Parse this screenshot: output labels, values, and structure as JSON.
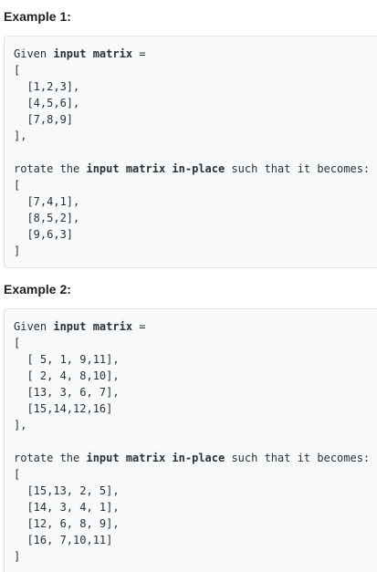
{
  "example1": {
    "heading": "Example 1:",
    "lines": [
      "Given input matrix =",
      "[",
      "  [1,2,3],",
      "  [4,5,6],",
      "  [7,8,9]",
      "],",
      "",
      "rotate the input matrix in-place such that it becomes:",
      "[",
      "  [7,4,1],",
      "  [8,5,2],",
      "  [9,6,3]",
      "]"
    ]
  },
  "example2": {
    "heading": "Example 2:",
    "lines": [
      "Given input matrix =",
      "[",
      "  [ 5, 1, 9,11],",
      "  [ 2, 4, 8,10],",
      "  [13, 3, 6, 7],",
      "  [15,14,12,16]",
      "],",
      "",
      "rotate the input matrix in-place such that it becomes:",
      "[",
      "  [15,13, 2, 5],",
      "  [14, 3, 4, 1],",
      "  [12, 6, 8, 9],",
      "  [16, 7,10,11]",
      "]"
    ]
  },
  "bold_terms": [
    "input matrix",
    "in-place"
  ]
}
